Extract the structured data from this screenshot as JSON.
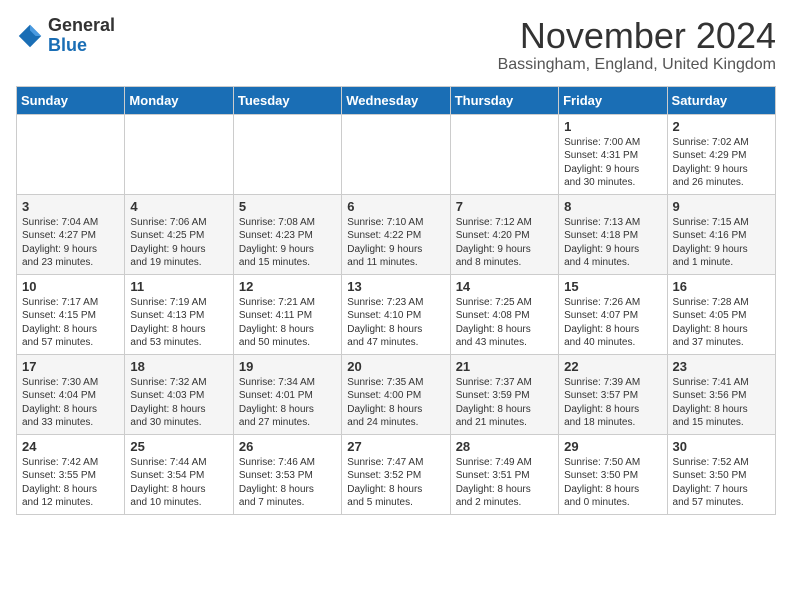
{
  "header": {
    "logo_general": "General",
    "logo_blue": "Blue",
    "month_title": "November 2024",
    "location": "Bassingham, England, United Kingdom"
  },
  "weekdays": [
    "Sunday",
    "Monday",
    "Tuesday",
    "Wednesday",
    "Thursday",
    "Friday",
    "Saturday"
  ],
  "weeks": [
    [
      {
        "day": "",
        "info": ""
      },
      {
        "day": "",
        "info": ""
      },
      {
        "day": "",
        "info": ""
      },
      {
        "day": "",
        "info": ""
      },
      {
        "day": "",
        "info": ""
      },
      {
        "day": "1",
        "info": "Sunrise: 7:00 AM\nSunset: 4:31 PM\nDaylight: 9 hours\nand 30 minutes."
      },
      {
        "day": "2",
        "info": "Sunrise: 7:02 AM\nSunset: 4:29 PM\nDaylight: 9 hours\nand 26 minutes."
      }
    ],
    [
      {
        "day": "3",
        "info": "Sunrise: 7:04 AM\nSunset: 4:27 PM\nDaylight: 9 hours\nand 23 minutes."
      },
      {
        "day": "4",
        "info": "Sunrise: 7:06 AM\nSunset: 4:25 PM\nDaylight: 9 hours\nand 19 minutes."
      },
      {
        "day": "5",
        "info": "Sunrise: 7:08 AM\nSunset: 4:23 PM\nDaylight: 9 hours\nand 15 minutes."
      },
      {
        "day": "6",
        "info": "Sunrise: 7:10 AM\nSunset: 4:22 PM\nDaylight: 9 hours\nand 11 minutes."
      },
      {
        "day": "7",
        "info": "Sunrise: 7:12 AM\nSunset: 4:20 PM\nDaylight: 9 hours\nand 8 minutes."
      },
      {
        "day": "8",
        "info": "Sunrise: 7:13 AM\nSunset: 4:18 PM\nDaylight: 9 hours\nand 4 minutes."
      },
      {
        "day": "9",
        "info": "Sunrise: 7:15 AM\nSunset: 4:16 PM\nDaylight: 9 hours\nand 1 minute."
      }
    ],
    [
      {
        "day": "10",
        "info": "Sunrise: 7:17 AM\nSunset: 4:15 PM\nDaylight: 8 hours\nand 57 minutes."
      },
      {
        "day": "11",
        "info": "Sunrise: 7:19 AM\nSunset: 4:13 PM\nDaylight: 8 hours\nand 53 minutes."
      },
      {
        "day": "12",
        "info": "Sunrise: 7:21 AM\nSunset: 4:11 PM\nDaylight: 8 hours\nand 50 minutes."
      },
      {
        "day": "13",
        "info": "Sunrise: 7:23 AM\nSunset: 4:10 PM\nDaylight: 8 hours\nand 47 minutes."
      },
      {
        "day": "14",
        "info": "Sunrise: 7:25 AM\nSunset: 4:08 PM\nDaylight: 8 hours\nand 43 minutes."
      },
      {
        "day": "15",
        "info": "Sunrise: 7:26 AM\nSunset: 4:07 PM\nDaylight: 8 hours\nand 40 minutes."
      },
      {
        "day": "16",
        "info": "Sunrise: 7:28 AM\nSunset: 4:05 PM\nDaylight: 8 hours\nand 37 minutes."
      }
    ],
    [
      {
        "day": "17",
        "info": "Sunrise: 7:30 AM\nSunset: 4:04 PM\nDaylight: 8 hours\nand 33 minutes."
      },
      {
        "day": "18",
        "info": "Sunrise: 7:32 AM\nSunset: 4:03 PM\nDaylight: 8 hours\nand 30 minutes."
      },
      {
        "day": "19",
        "info": "Sunrise: 7:34 AM\nSunset: 4:01 PM\nDaylight: 8 hours\nand 27 minutes."
      },
      {
        "day": "20",
        "info": "Sunrise: 7:35 AM\nSunset: 4:00 PM\nDaylight: 8 hours\nand 24 minutes."
      },
      {
        "day": "21",
        "info": "Sunrise: 7:37 AM\nSunset: 3:59 PM\nDaylight: 8 hours\nand 21 minutes."
      },
      {
        "day": "22",
        "info": "Sunrise: 7:39 AM\nSunset: 3:57 PM\nDaylight: 8 hours\nand 18 minutes."
      },
      {
        "day": "23",
        "info": "Sunrise: 7:41 AM\nSunset: 3:56 PM\nDaylight: 8 hours\nand 15 minutes."
      }
    ],
    [
      {
        "day": "24",
        "info": "Sunrise: 7:42 AM\nSunset: 3:55 PM\nDaylight: 8 hours\nand 12 minutes."
      },
      {
        "day": "25",
        "info": "Sunrise: 7:44 AM\nSunset: 3:54 PM\nDaylight: 8 hours\nand 10 minutes."
      },
      {
        "day": "26",
        "info": "Sunrise: 7:46 AM\nSunset: 3:53 PM\nDaylight: 8 hours\nand 7 minutes."
      },
      {
        "day": "27",
        "info": "Sunrise: 7:47 AM\nSunset: 3:52 PM\nDaylight: 8 hours\nand 5 minutes."
      },
      {
        "day": "28",
        "info": "Sunrise: 7:49 AM\nSunset: 3:51 PM\nDaylight: 8 hours\nand 2 minutes."
      },
      {
        "day": "29",
        "info": "Sunrise: 7:50 AM\nSunset: 3:50 PM\nDaylight: 8 hours\nand 0 minutes."
      },
      {
        "day": "30",
        "info": "Sunrise: 7:52 AM\nSunset: 3:50 PM\nDaylight: 7 hours\nand 57 minutes."
      }
    ]
  ]
}
